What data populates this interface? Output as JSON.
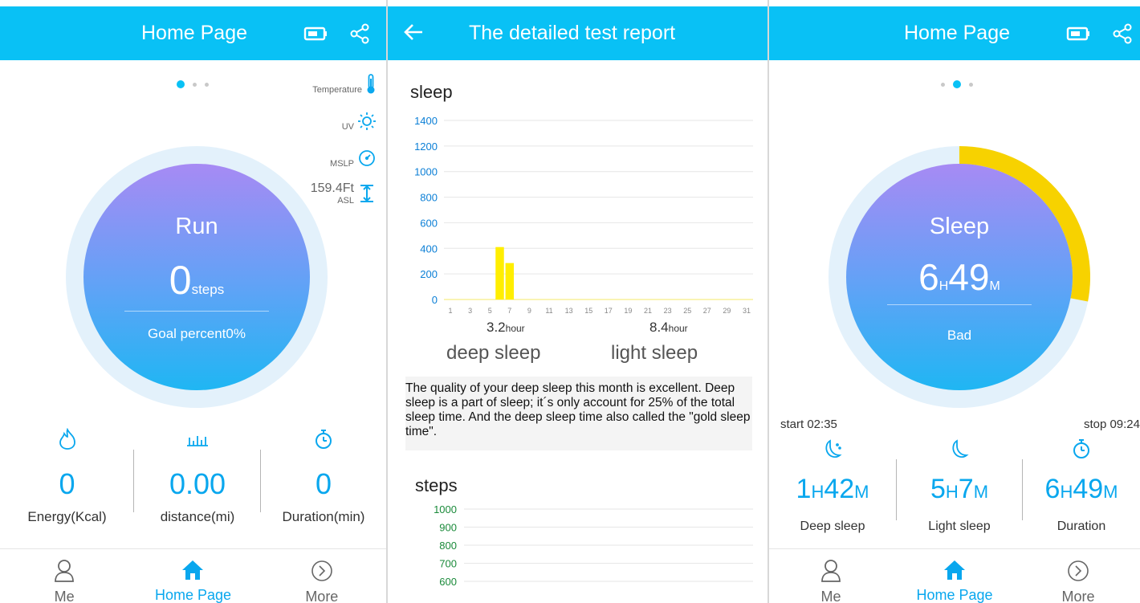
{
  "left": {
    "header": {
      "title": "Home Page"
    },
    "sensors": {
      "temperature": "Temperature",
      "uv": "UV",
      "mslp": "MSLP",
      "altitude_value": "159.4Ft",
      "altitude_unit": "ASL"
    },
    "circle": {
      "activity": "Run",
      "steps_value": "0",
      "steps_unit": "steps",
      "goal_text": "Goal percent0%"
    },
    "stats": [
      {
        "icon": "fire-icon",
        "value": "0",
        "label": "Energy(Kcal)"
      },
      {
        "icon": "bar-chart-icon",
        "value": "0.00",
        "label": "distance(mi)"
      },
      {
        "icon": "stopwatch-icon",
        "value": "0",
        "label": "Duration(min)"
      }
    ],
    "nav": [
      {
        "label": "Me"
      },
      {
        "label": "Home Page"
      },
      {
        "label": "More"
      }
    ]
  },
  "middle": {
    "header": {
      "back_icon": "arrow-left-icon",
      "title": "The detailed test report"
    },
    "sleep_chart_title": "sleep",
    "steps_chart_title": "steps",
    "deep_sleep_value": "3.2",
    "deep_sleep_unit": "hour",
    "deep_sleep_label": "deep sleep",
    "light_sleep_value": "8.4",
    "light_sleep_unit": "hour",
    "light_sleep_label": "light sleep",
    "description": "The quality of your deep sleep this month is excellent. Deep sleep is a part of sleep; it´s only account for 25% of the total sleep time. And the deep sleep time also called the \"gold sleep time\"."
  },
  "right": {
    "header": {
      "title": "Home Page"
    },
    "circle": {
      "title": "Sleep",
      "hours": "6",
      "hours_unit": "H",
      "minutes": "49",
      "minutes_unit": "M",
      "quality": "Bad"
    },
    "start_time": "start 02:35",
    "stop_time": "stop 09:24",
    "stats": [
      {
        "icon": "moon-stars-icon",
        "hours": "1",
        "minutes": "42",
        "label": "Deep sleep"
      },
      {
        "icon": "moon-icon",
        "hours": "5",
        "minutes": "7",
        "label": "Light sleep"
      },
      {
        "icon": "stopwatch-icon",
        "hours": "6",
        "minutes": "49",
        "label": "Duration"
      }
    ],
    "h_unit": "H",
    "m_unit": "M",
    "progress_fraction": 0.28,
    "nav": [
      {
        "label": "Me"
      },
      {
        "label": "Home Page"
      },
      {
        "label": "More"
      }
    ]
  },
  "colors": {
    "header": "#09c1f5",
    "accent": "#09a7ee",
    "bar": "#ffee00",
    "progress": "#f7d200"
  },
  "chart_data": [
    {
      "type": "bar",
      "title": "sleep",
      "categories": [
        "1",
        "2",
        "3",
        "4",
        "5",
        "6",
        "7",
        "8",
        "9",
        "10",
        "11",
        "12",
        "13",
        "14",
        "15",
        "16",
        "17",
        "18",
        "19",
        "20",
        "21",
        "22",
        "23",
        "24",
        "25",
        "26",
        "27",
        "28",
        "29",
        "30",
        "31"
      ],
      "x_tick_labels": [
        "1",
        "3",
        "5",
        "7",
        "9",
        "11",
        "13",
        "15",
        "17",
        "19",
        "21",
        "23",
        "25",
        "27",
        "29",
        "31"
      ],
      "values": [
        0,
        0,
        0,
        0,
        0,
        410,
        285,
        0,
        0,
        0,
        0,
        0,
        0,
        0,
        0,
        0,
        0,
        0,
        0,
        0,
        0,
        0,
        0,
        0,
        0,
        0,
        0,
        0,
        0,
        0,
        0
      ],
      "y_ticks": [
        0,
        200,
        400,
        600,
        800,
        1000,
        1200,
        1400
      ],
      "ylim": [
        0,
        1400
      ],
      "grid": true
    },
    {
      "type": "bar",
      "title": "steps",
      "y_ticks": [
        600,
        700,
        800,
        900,
        1000
      ],
      "ylim": [
        600,
        1000
      ],
      "grid": true
    }
  ]
}
